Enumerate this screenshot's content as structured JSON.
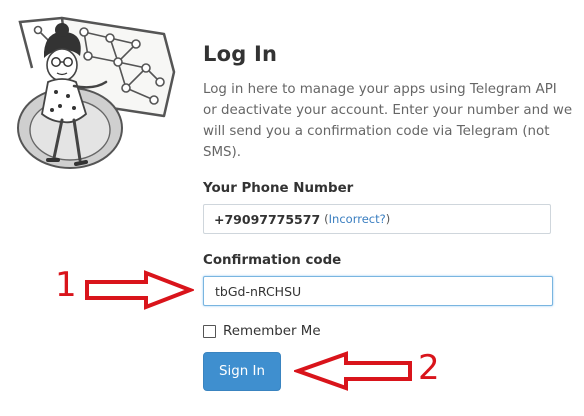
{
  "login": {
    "title": "Log In",
    "description": "Log in here to manage your apps using Telegram API or deactivate your account. Enter your number and we will send you a confirmation code via Telegram (not SMS)."
  },
  "phone": {
    "label": "Your Phone Number",
    "value": "+79097775577",
    "incorrect_open": "(",
    "incorrect_link": "Incorrect?",
    "incorrect_close": ")"
  },
  "code": {
    "label": "Confirmation code",
    "value": "tbGd-nRCHSU"
  },
  "remember": {
    "label": "Remember Me",
    "checked": false
  },
  "signin": {
    "label": "Sign In"
  },
  "annotations": {
    "marker_1": "1",
    "marker_2": "2",
    "color": "#d9141b"
  },
  "colors": {
    "button": "#3f8fcf",
    "link": "#3a7ec0",
    "input_focus_border": "#7ab5e0"
  },
  "icons": {
    "illustration": "telegram-woman-network-illustration",
    "arrow": "outlined-red-arrow"
  }
}
